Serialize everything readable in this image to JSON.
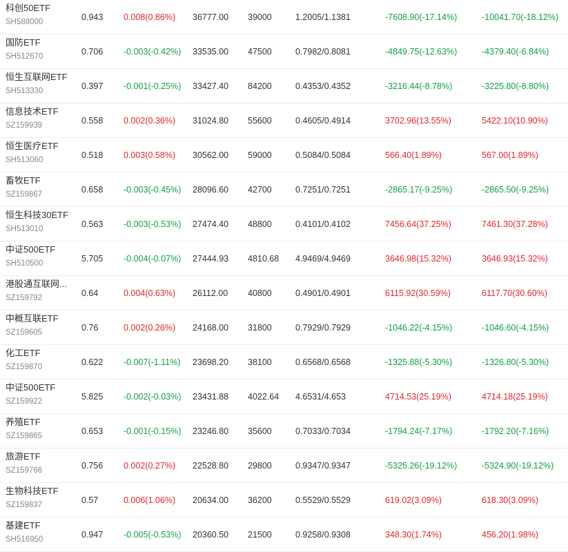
{
  "colors": {
    "up": "#e0262b",
    "down": "#10a040",
    "text": "#333333",
    "code": "#888888"
  },
  "rows": [
    {
      "name": "科创50ETF",
      "code": "SH588000",
      "price": "0.943",
      "chg": "0.008(0.86%)",
      "chg_dir": "up",
      "amount": "36777.00",
      "volume": "39000",
      "nav": "1.2005/1.1381",
      "pl1": "-7608.90(-17.14%)",
      "pl1_dir": "down",
      "pl2": "-10041.70(-18.12%)",
      "pl2_dir": "down"
    },
    {
      "name": "国防ETF",
      "code": "SH512670",
      "price": "0.706",
      "chg": "-0.003(-0.42%)",
      "chg_dir": "down",
      "amount": "33535.00",
      "volume": "47500",
      "nav": "0.7982/0.8081",
      "pl1": "-4849.75(-12.63%)",
      "pl1_dir": "down",
      "pl2": "-4379.40(-6.84%)",
      "pl2_dir": "down"
    },
    {
      "name": "恒生互联网ETF",
      "code": "SH513330",
      "price": "0.397",
      "chg": "-0.001(-0.25%)",
      "chg_dir": "down",
      "amount": "33427.40",
      "volume": "84200",
      "nav": "0.4353/0.4352",
      "pl1": "-3216.44(-8.78%)",
      "pl1_dir": "down",
      "pl2": "-3225.80(-8.80%)",
      "pl2_dir": "down"
    },
    {
      "name": "信息技术ETF",
      "code": "SZ159939",
      "price": "0.558",
      "chg": "0.002(0.36%)",
      "chg_dir": "up",
      "amount": "31024.80",
      "volume": "55600",
      "nav": "0.4605/0.4914",
      "pl1": "3702.96(13.55%)",
      "pl1_dir": "up",
      "pl2": "5422.10(10.90%)",
      "pl2_dir": "up"
    },
    {
      "name": "恒生医疗ETF",
      "code": "SH513060",
      "price": "0.518",
      "chg": "0.003(0.58%)",
      "chg_dir": "up",
      "amount": "30562.00",
      "volume": "59000",
      "nav": "0.5084/0.5084",
      "pl1": "566.40(1.89%)",
      "pl1_dir": "up",
      "pl2": "567.00(1.89%)",
      "pl2_dir": "up"
    },
    {
      "name": "畜牧ETF",
      "code": "SZ159867",
      "price": "0.658",
      "chg": "-0.003(-0.45%)",
      "chg_dir": "down",
      "amount": "28096.60",
      "volume": "42700",
      "nav": "0.7251/0.7251",
      "pl1": "-2865.17(-9.25%)",
      "pl1_dir": "down",
      "pl2": "-2865.50(-9.25%)",
      "pl2_dir": "down"
    },
    {
      "name": "恒生科技30ETF",
      "code": "SH513010",
      "price": "0.563",
      "chg": "-0.003(-0.53%)",
      "chg_dir": "down",
      "amount": "27474.40",
      "volume": "48800",
      "nav": "0.4101/0.4102",
      "pl1": "7456.64(37.25%)",
      "pl1_dir": "up",
      "pl2": "7461.30(37.28%)",
      "pl2_dir": "up"
    },
    {
      "name": "中证500ETF",
      "code": "SH510500",
      "price": "5.705",
      "chg": "-0.004(-0.07%)",
      "chg_dir": "down",
      "amount": "27444.93",
      "volume": "4810.68",
      "nav": "4.9469/4.9469",
      "pl1": "3646.98(15.32%)",
      "pl1_dir": "up",
      "pl2": "3646.93(15.32%)",
      "pl2_dir": "up"
    },
    {
      "name": "港股通互联网...",
      "code": "SZ159792",
      "price": "0.64",
      "chg": "0.004(0.63%)",
      "chg_dir": "up",
      "amount": "26112.00",
      "volume": "40800",
      "nav": "0.4901/0.4901",
      "pl1": "6115.92(30.59%)",
      "pl1_dir": "up",
      "pl2": "6117.70(30.60%)",
      "pl2_dir": "up"
    },
    {
      "name": "中概互联ETF",
      "code": "SZ159605",
      "price": "0.76",
      "chg": "0.002(0.26%)",
      "chg_dir": "up",
      "amount": "24168.00",
      "volume": "31800",
      "nav": "0.7929/0.7929",
      "pl1": "-1046.22(-4.15%)",
      "pl1_dir": "down",
      "pl2": "-1046.60(-4.15%)",
      "pl2_dir": "down"
    },
    {
      "name": "化工ETF",
      "code": "SZ159870",
      "price": "0.622",
      "chg": "-0.007(-1.11%)",
      "chg_dir": "down",
      "amount": "23698.20",
      "volume": "38100",
      "nav": "0.6568/0.6568",
      "pl1": "-1325.88(-5.30%)",
      "pl1_dir": "down",
      "pl2": "-1326.80(-5.30%)",
      "pl2_dir": "down"
    },
    {
      "name": "中证500ETF",
      "code": "SZ159922",
      "price": "5.825",
      "chg": "-0.002(-0.03%)",
      "chg_dir": "down",
      "amount": "23431.88",
      "volume": "4022.64",
      "nav": "4.6531/4.653",
      "pl1": "4714.53(25.19%)",
      "pl1_dir": "up",
      "pl2": "4714.18(25.19%)",
      "pl2_dir": "up"
    },
    {
      "name": "养殖ETF",
      "code": "SZ159865",
      "price": "0.653",
      "chg": "-0.001(-0.15%)",
      "chg_dir": "down",
      "amount": "23246.80",
      "volume": "35600",
      "nav": "0.7033/0.7034",
      "pl1": "-1794.24(-7.17%)",
      "pl1_dir": "down",
      "pl2": "-1792.20(-7.16%)",
      "pl2_dir": "down"
    },
    {
      "name": "旅游ETF",
      "code": "SZ159766",
      "price": "0.756",
      "chg": "0.002(0.27%)",
      "chg_dir": "up",
      "amount": "22528.80",
      "volume": "29800",
      "nav": "0.9347/0.9347",
      "pl1": "-5325.26(-19.12%)",
      "pl1_dir": "down",
      "pl2": "-5324.90(-19.12%)",
      "pl2_dir": "down"
    },
    {
      "name": "生物科技ETF",
      "code": "SZ159837",
      "price": "0.57",
      "chg": "0.006(1.06%)",
      "chg_dir": "up",
      "amount": "20634.00",
      "volume": "36200",
      "nav": "0.5529/0.5529",
      "pl1": "619.02(3.09%)",
      "pl1_dir": "up",
      "pl2": "618.30(3.09%)",
      "pl2_dir": "up"
    },
    {
      "name": "基建ETF",
      "code": "SH516950",
      "price": "0.947",
      "chg": "-0.005(-0.53%)",
      "chg_dir": "down",
      "amount": "20360.50",
      "volume": "21500",
      "nav": "0.9258/0.9308",
      "pl1": "348.30(1.74%)",
      "pl1_dir": "up",
      "pl2": "456.20(1.98%)",
      "pl2_dir": "up"
    }
  ]
}
